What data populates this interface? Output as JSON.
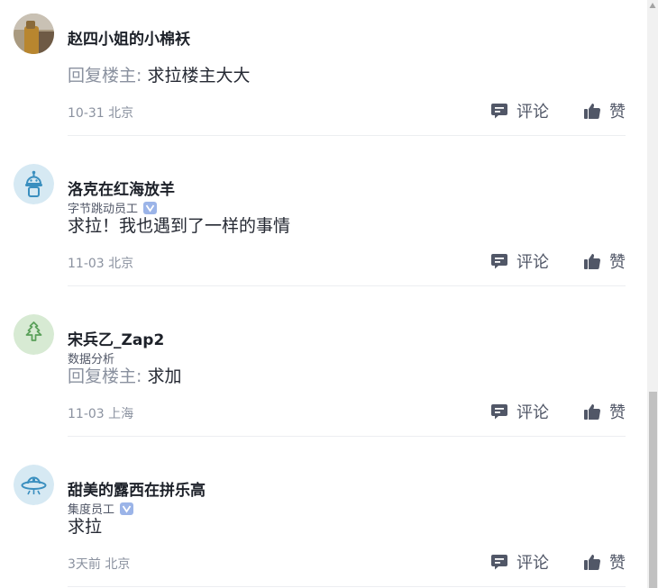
{
  "comments": [
    {
      "user": "赵四小姐的小棉袄",
      "title": "",
      "verified": false,
      "reply_prefix": "回复楼主: ",
      "text": "求拉楼主大大",
      "meta": "10-31 北京",
      "comment_label": "评论",
      "like_label": "赞",
      "avatar": "photo-avatar"
    },
    {
      "user": "洛克在红海放羊",
      "title": "字节跳动员工",
      "verified": true,
      "reply_prefix": "",
      "text": "求拉！我也遇到了一样的事情",
      "meta": "11-03 北京",
      "comment_label": "评论",
      "like_label": "赞",
      "avatar": "robot-avatar"
    },
    {
      "user": "宋兵乙_Zap2",
      "title": "数据分析",
      "verified": false,
      "reply_prefix": "回复楼主: ",
      "text": "求加",
      "meta": "11-03 上海",
      "comment_label": "评论",
      "like_label": "赞",
      "avatar": "tree-avatar"
    },
    {
      "user": "甜美的露西在拼乐高",
      "title": "集度员工",
      "verified": true,
      "reply_prefix": "",
      "text": "求拉",
      "meta": "3天前 北京",
      "comment_label": "评论",
      "like_label": "赞",
      "avatar": "ufo-avatar"
    }
  ],
  "icons": {
    "comment": "comment-bubble-icon",
    "like": "thumbs-up-icon",
    "verified": "verified-badge-icon"
  },
  "colors": {
    "muted": "#8a919f",
    "text": "#252933",
    "action": "#515767",
    "divider": "#eceef1",
    "verified": "#9bb4e8"
  }
}
